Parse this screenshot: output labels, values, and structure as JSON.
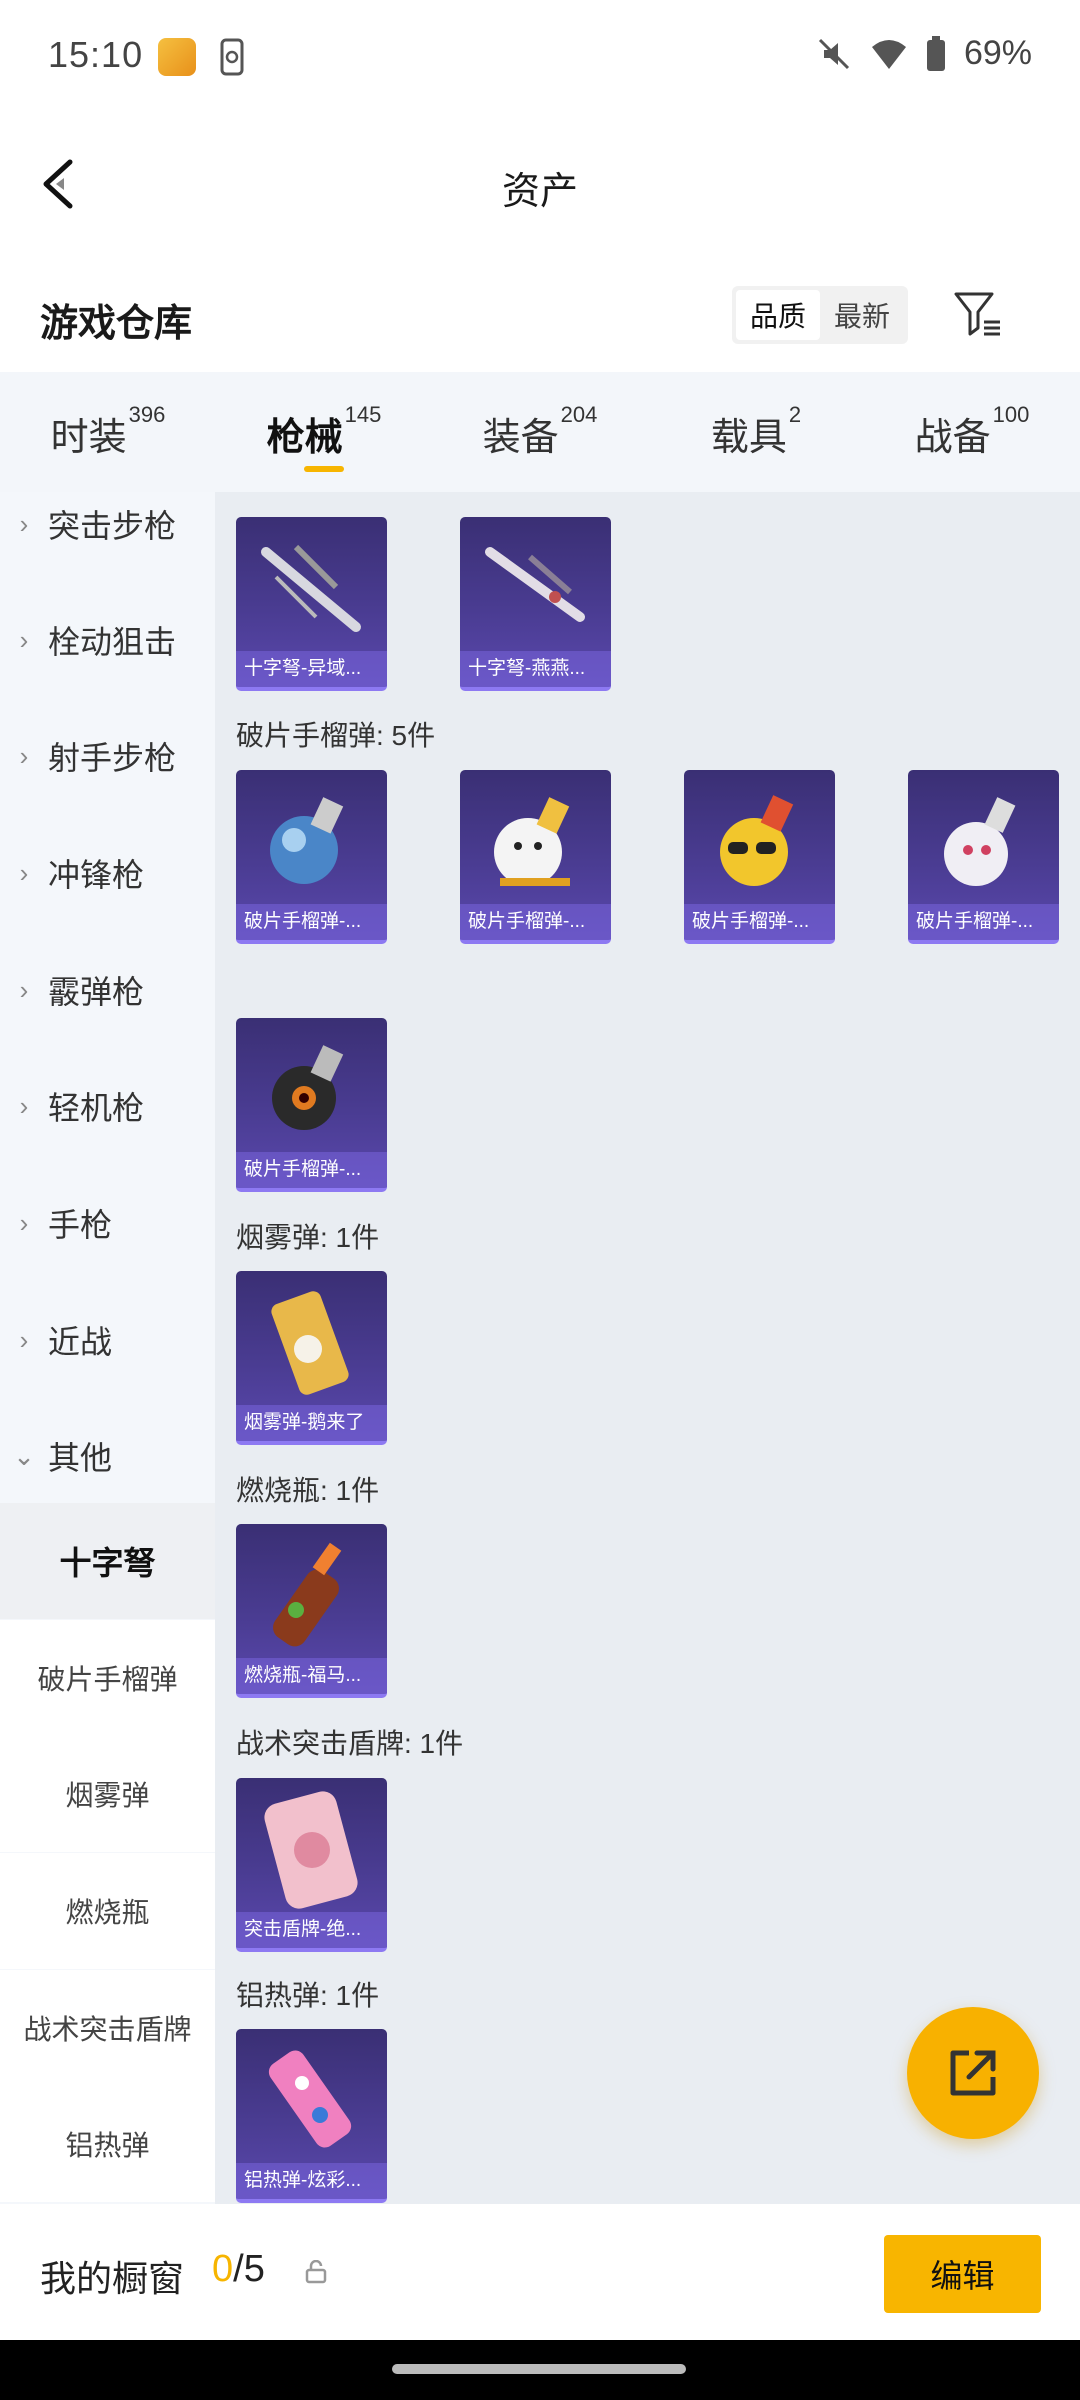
{
  "status_bar": {
    "time": "15:10",
    "battery": "69%"
  },
  "header": {
    "title": "资产"
  },
  "warehouse": {
    "title": "游戏仓库",
    "sort_options": [
      "品质",
      "最新"
    ]
  },
  "tabs": [
    {
      "label": "时装",
      "count": "396"
    },
    {
      "label": "枪械",
      "count": "145"
    },
    {
      "label": "装备",
      "count": "204"
    },
    {
      "label": "载具",
      "count": "2"
    },
    {
      "label": "战备",
      "count": "100"
    }
  ],
  "sidebar": {
    "categories": [
      "突击步枪",
      "栓动狙击",
      "射手步枪",
      "冲锋枪",
      "霰弹枪",
      "轻机枪",
      "手枪",
      "近战",
      "其他"
    ],
    "sub_items": [
      "十字弩",
      "破片手榴弹",
      "烟雾弹",
      "燃烧瓶",
      "战术突击盾牌",
      "铝热弹"
    ]
  },
  "groups": [
    {
      "label": "",
      "items": [
        "十字弩-异域...",
        "十字弩-燕燕..."
      ]
    },
    {
      "label": "破片手榴弹: 5件",
      "items": [
        "破片手榴弹-...",
        "破片手榴弹-...",
        "破片手榴弹-...",
        "破片手榴弹-...",
        "破片手榴弹-..."
      ]
    },
    {
      "label": "烟雾弹: 1件",
      "items": [
        "烟雾弹-鹅来了"
      ]
    },
    {
      "label": "燃烧瓶: 1件",
      "items": [
        "燃烧瓶-福马..."
      ]
    },
    {
      "label": "战术突击盾牌: 1件",
      "items": [
        "突击盾牌-绝..."
      ]
    },
    {
      "label": "铝热弹: 1件",
      "items": [
        "铝热弹-炫彩..."
      ]
    }
  ],
  "showcase": {
    "label": "我的橱窗",
    "current": "0",
    "total": "/5",
    "edit_label": "编辑"
  },
  "colors": {
    "accent": "#f7b500",
    "card_bg": "#4a3c92"
  }
}
